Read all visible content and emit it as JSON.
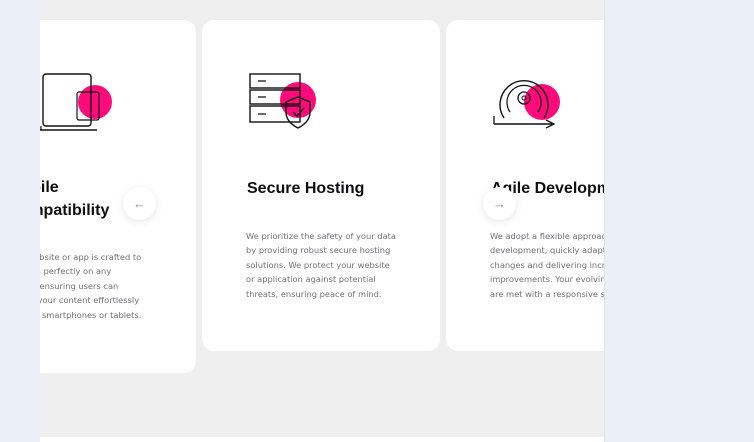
{
  "carousel": {
    "prev_arrow": "←",
    "next_arrow": "→",
    "cards": [
      {
        "icon": "mobile-compatibility-icon",
        "title_lines": [
          "Mobile",
          "Compatibility"
        ],
        "text_lines": [
          "Your website or app is crafted to",
          "function perfectly on any",
          "device, ensuring users can",
          "access your content effortlessly",
          "on their smartphones or tablets."
        ]
      },
      {
        "icon": "secure-server-shield-icon",
        "title": "Secure Hosting",
        "text_lines": [
          "We prioritize the safety of your data",
          "by providing robust secure hosting",
          "solutions. We protect your website",
          "or application against potential",
          "threats, ensuring peace of mind."
        ]
      },
      {
        "icon": "agile-cycle-gear-icon",
        "title": "Agile Development",
        "text_lines": [
          "We adopt a flexible approach to",
          "development, quickly adapting to",
          "changes and delivering incremental",
          "improvements. Your evolving needs",
          "are met with a responsive solution."
        ]
      }
    ]
  },
  "colors": {
    "accent": "#ff0a7a",
    "card_bg": "#ffffff",
    "page_bg": "#efefef"
  }
}
